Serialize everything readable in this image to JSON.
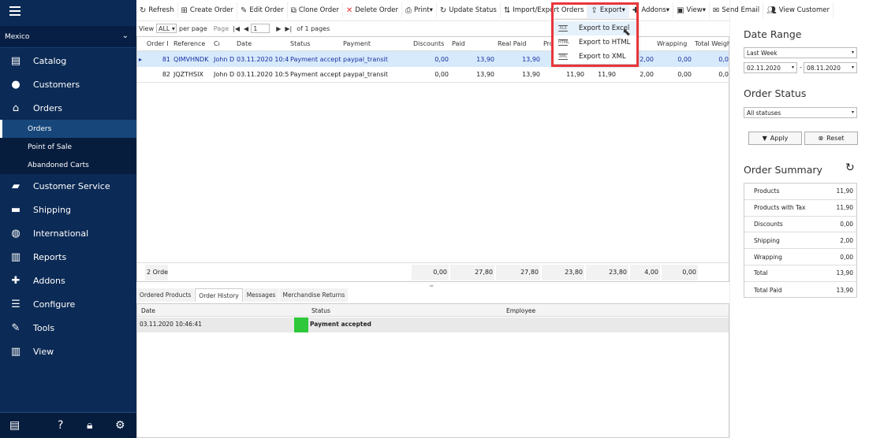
{
  "sidebar": {
    "store": "Mexico",
    "items": [
      {
        "label": "Catalog",
        "icon": "catalog-box-icon"
      },
      {
        "label": "Customers",
        "icon": "user-icon"
      },
      {
        "label": "Orders",
        "icon": "basket-icon"
      },
      {
        "label": "Customer Service",
        "icon": "chat-icon"
      },
      {
        "label": "Shipping",
        "icon": "truck-icon"
      },
      {
        "label": "International",
        "icon": "globe-icon"
      },
      {
        "label": "Reports",
        "icon": "bar-chart-icon"
      },
      {
        "label": "Addons",
        "icon": "puzzle-icon"
      },
      {
        "label": "Configure",
        "icon": "sliders-icon"
      },
      {
        "label": "Tools",
        "icon": "wrench-icon"
      },
      {
        "label": "View",
        "icon": "view-chart-icon"
      }
    ],
    "orders_sub": [
      "Orders",
      "Point of Sale",
      "Abandoned Carts"
    ]
  },
  "toolbar": {
    "refresh": "Refresh",
    "create": "Create Order",
    "edit": "Edit Order",
    "clone": "Clone Order",
    "delete": "Delete Order",
    "print": "Print",
    "update": "Update Status",
    "import": "Import/Export Orders",
    "export": "Export",
    "addons": "Addons",
    "view": "View",
    "email": "Send Email",
    "viewcust": "View Customer"
  },
  "export_menu": [
    "Export to Excel",
    "Export to HTML",
    "Export to XML"
  ],
  "pager": {
    "view": "View",
    "count": "ALL",
    "per_page": "per page",
    "page": "Page",
    "current": "1",
    "of": "of 1 pages"
  },
  "grid": {
    "columns": [
      "Order I",
      "Reference",
      "Cı",
      "Date",
      "Status",
      "Payment",
      "Discounts",
      "Paid",
      "Real Paid",
      "Pro",
      "",
      "g C",
      "Wrapping",
      "Total Weigh"
    ],
    "rows": [
      [
        "81",
        "QIMVHNDK",
        "John D",
        "03.11.2020 10:46:4",
        "Payment accepted",
        "paypal_transit",
        "0,00",
        "13,90",
        "13,90",
        "",
        "",
        "2,00",
        "0,00",
        "0,0"
      ],
      [
        "82",
        "JQZTHSIX",
        "John D",
        "03.11.2020 10:50:3",
        "Payment accepted",
        "paypal_transit",
        "0,00",
        "13,90",
        "13,90",
        "11,90",
        "11,90",
        "2,00",
        "0,00",
        "0,0"
      ]
    ],
    "footer": {
      "count": "2 Orde",
      "values": [
        "0,00",
        "27,80",
        "27,80",
        "23,80",
        "23,80",
        "4,00",
        "0,00"
      ]
    }
  },
  "bottom_tabs": [
    "Ordered Products",
    "Order History",
    "Messages",
    "Merchandise Returns"
  ],
  "history": {
    "columns": [
      "Date",
      "Status",
      "Employee"
    ],
    "rows": [
      {
        "date": "03.11.2020 10:46:41",
        "status": "Payment accepted",
        "employee": "",
        "color": "#2ec83a"
      }
    ]
  },
  "right": {
    "date_range_title": "Date Range",
    "range": "Last Week",
    "from": "02.11.2020",
    "sep": "-",
    "to": "08.11.2020",
    "order_status_title": "Order Status",
    "status": "All statuses",
    "apply": "Apply",
    "reset": "Reset",
    "summary_title": "Order Summary",
    "summary": [
      {
        "label": "Products",
        "value": "11,90"
      },
      {
        "label": "Products with Tax",
        "value": "11,90"
      },
      {
        "label": "Discounts",
        "value": "0,00"
      },
      {
        "label": "Shipping",
        "value": "2,00"
      },
      {
        "label": "Wrapping",
        "value": "0,00"
      },
      {
        "label": "Total",
        "value": "13,90"
      },
      {
        "label": "Total Paid",
        "value": "13,90"
      }
    ]
  },
  "colors": {
    "sidebar": "#0b2a55",
    "highlight": "#e8363a",
    "selected_row": "#d7eafc"
  }
}
